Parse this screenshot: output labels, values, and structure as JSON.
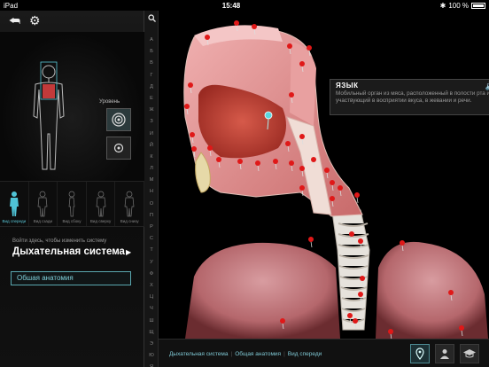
{
  "status": {
    "carrier": "iPad",
    "time": "15:48",
    "battery": "100 %"
  },
  "panel": {
    "level_label": "Уровень",
    "views": [
      {
        "label": "Вид спереди",
        "active": true
      },
      {
        "label": "Вид сзади",
        "active": false
      },
      {
        "label": "Вид сбоку",
        "active": false
      },
      {
        "label": "Вид сверху",
        "active": false
      },
      {
        "label": "Вид снизу",
        "active": false
      }
    ],
    "hint": "Войти здесь, чтобы изменить систему",
    "system_title": "Дыхательная система",
    "anatomy_button": "Обшая анатомия"
  },
  "index_letters": [
    "А",
    "Б",
    "В",
    "Г",
    "Д",
    "Е",
    "Ж",
    "З",
    "И",
    "Й",
    "К",
    "Л",
    "М",
    "Н",
    "О",
    "П",
    "Р",
    "С",
    "Т",
    "У",
    "Ф",
    "Х",
    "Ц",
    "Ч",
    "Ш",
    "Щ",
    "Э",
    "Ю",
    "Я"
  ],
  "tooltip": {
    "title": "ЯЗЫК",
    "description": "Мобильный орган из мяса, расположенный в полости рта и участвующий в восприятии вкуса, в жевании и речи."
  },
  "breadcrumbs": [
    "Дыхательная система",
    "Общая анатомия",
    "Вид спереди"
  ],
  "icons": {
    "back": "back-arrow-icon",
    "settings": "gear-icon",
    "search": "search-icon",
    "speaker": "speaker-icon",
    "pin": "pin-icon",
    "person": "person-icon",
    "education": "graduation-cap-icon"
  },
  "colors": {
    "accent": "#5ac8d8",
    "pin": "#e01818"
  }
}
